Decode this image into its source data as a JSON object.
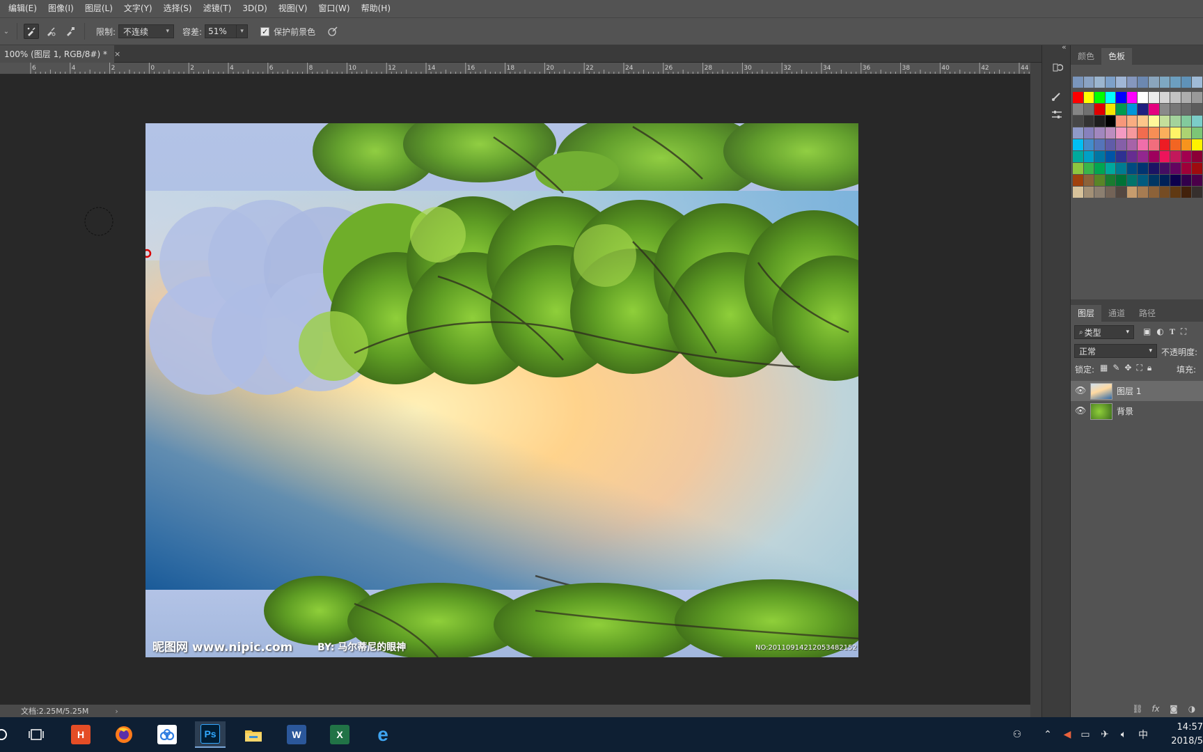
{
  "menubar": {
    "items": [
      "编辑(E)",
      "图像(I)",
      "图层(L)",
      "文字(Y)",
      "选择(S)",
      "滤镜(T)",
      "3D(D)",
      "视图(V)",
      "窗口(W)",
      "帮助(H)"
    ]
  },
  "options": {
    "limit_label": "限制:",
    "limit_value": "不连续",
    "tolerance_label": "容差:",
    "tolerance_value": "51%",
    "protect_label": "保护前景色",
    "protect_checked": true
  },
  "document": {
    "tab_title": "100% (图层 1, RGB/8#) *",
    "tab_close": "×",
    "ruler_labels": [
      "6",
      "4",
      "2",
      "0",
      "2",
      "4",
      "6",
      "8",
      "10",
      "12",
      "14",
      "16",
      "18",
      "20",
      "22",
      "24",
      "26",
      "28",
      "30",
      "32",
      "34",
      "36",
      "38",
      "40",
      "42",
      "44"
    ],
    "status_text": "文档:2.25M/5.25M",
    "status_chevron": "›",
    "watermark_left": "昵图网 www.nipic.com",
    "watermark_by": "BY: 马尔蒂尼的眼神",
    "watermark_no": "NO:20110914212053482152"
  },
  "colors": {
    "accent_red": "#d80000",
    "canvas_bg": "#282828",
    "panel_bg": "#535353"
  },
  "color_panel": {
    "tabs": [
      "颜色",
      "色板"
    ],
    "active_tab": "色板",
    "swatch_rows": [
      [
        "#7a96bd",
        "#8aa3c4",
        "#9bb5cf",
        "#7da0c9",
        "#a0b6d6",
        "#8597be",
        "#6c88b1",
        "#8aa5bd",
        "#7ea8c2",
        "#6c9fc0",
        "#5f92b8",
        "#9fbad6"
      ],
      [
        "#ff0000",
        "#ffff00",
        "#00ff00",
        "#00ffff",
        "#0000ff",
        "#ff00ff",
        "#ffffff",
        "#ebebeb",
        "#d6d6d6",
        "#c2c2c2",
        "#adadad",
        "#999999"
      ],
      [
        "#858585",
        "#707070",
        "#e00000",
        "#f5e600",
        "#009b4e",
        "#0096da",
        "#202080",
        "#e4007f",
        "#8a8a8a",
        "#777777",
        "#6a6a6a",
        "#5c5c5c"
      ],
      [
        "#474747",
        "#333333",
        "#1e1e1e",
        "#000000",
        "#f7977a",
        "#f9ad81",
        "#fdc68a",
        "#fff79a",
        "#c4df9b",
        "#a3d39c",
        "#82ca9d",
        "#7bcdc8"
      ],
      [
        "#8f9ac9",
        "#8781bd",
        "#a187be",
        "#bc8dbf",
        "#f49ac2",
        "#f6989d",
        "#f26c4f",
        "#f68e55",
        "#fbaf5c",
        "#fff467",
        "#acd372",
        "#7cc576"
      ],
      [
        "#00bff3",
        "#438ccb",
        "#5574b9",
        "#605ca8",
        "#855fa8",
        "#a763a8",
        "#f06eaa",
        "#f26d7d",
        "#ed1c24",
        "#f26522",
        "#f7941d",
        "#fff200"
      ],
      [
        "#00a99d",
        "#00a0c6",
        "#0076a3",
        "#0054a6",
        "#2e3192",
        "#662d91",
        "#92278f",
        "#9e005d",
        "#ed145b",
        "#c2185b",
        "#a2004f",
        "#8b0036"
      ],
      [
        "#8dc63f",
        "#39b54a",
        "#00a651",
        "#00a99d",
        "#007c91",
        "#004a80",
        "#003471",
        "#1b1464",
        "#440e62",
        "#630460",
        "#9e0039",
        "#9e0b0f"
      ],
      [
        "#a0410d",
        "#8c6239",
        "#598527",
        "#1a7b30",
        "#007236",
        "#00746b",
        "#005b7f",
        "#003663",
        "#002157",
        "#0d004c",
        "#32004b",
        "#4b0049"
      ],
      [
        "#d7c29b",
        "#a39076",
        "#8c7f70",
        "#736357",
        "#534741",
        "#c69c6d",
        "#a67c52",
        "#8c6239",
        "#754c24",
        "#603913",
        "#42210b",
        "#362f2d"
      ]
    ]
  },
  "layers_panel": {
    "tabs": [
      "图层",
      "通道",
      "路径"
    ],
    "active_tab": "图层",
    "filter_label": "类型",
    "blend_mode": "正常",
    "opacity_label": "不透明度:",
    "lock_label": "锁定:",
    "fill_label": "填充:",
    "layers": [
      {
        "name": "图层 1",
        "visible": true,
        "selected": true
      },
      {
        "name": "背景",
        "visible": true,
        "selected": false
      }
    ],
    "bottom_fx": "fx"
  },
  "taskbar": {
    "ime_label": "中",
    "time": "14:57",
    "date": "2018/5"
  }
}
